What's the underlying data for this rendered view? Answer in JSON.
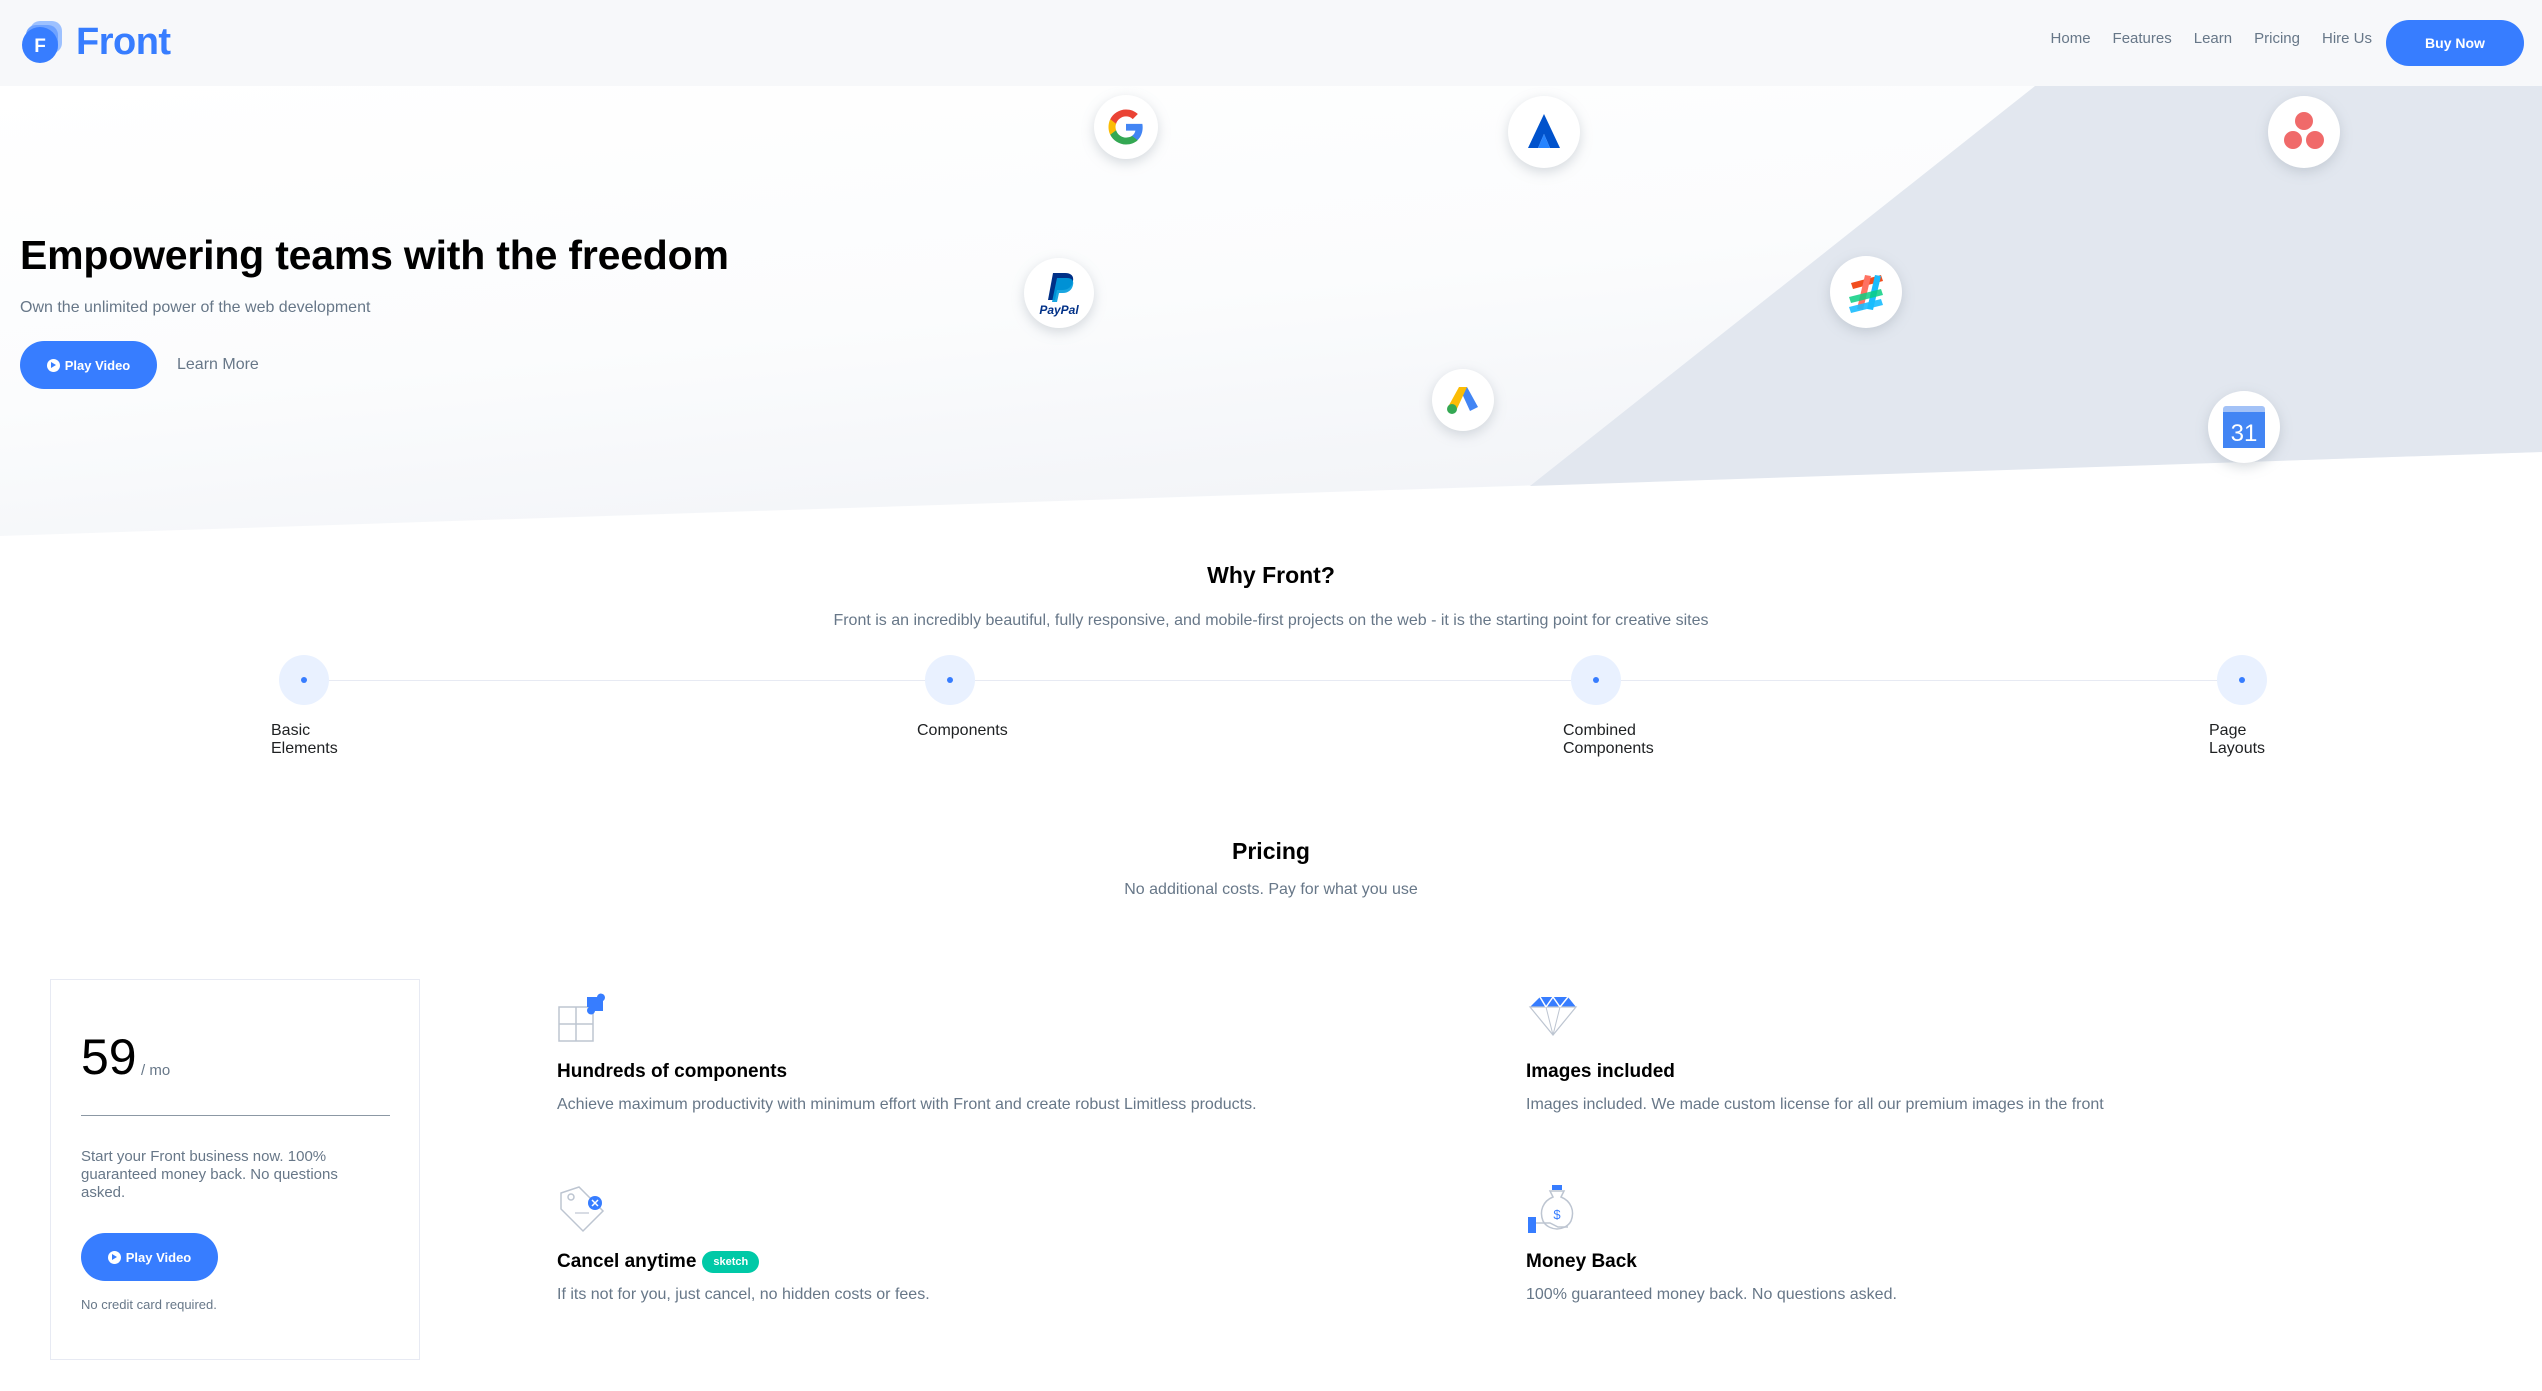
{
  "brand": {
    "name": "Front",
    "logo_letter": "F",
    "accent": "#377dff"
  },
  "nav": {
    "items": [
      "Home",
      "Features",
      "Learn",
      "Pricing",
      "Hire Us"
    ],
    "buy_label": "Buy Now"
  },
  "hero": {
    "title": "Empowering teams with the freedom",
    "subtitle": "Own the unlimited power of the web development",
    "play_label": "Play Video",
    "learn_more_label": "Learn More",
    "logos": [
      "google-icon",
      "atlassian-icon",
      "asana-icon",
      "paypal-icon",
      "zeplin-icon",
      "google-ads-icon",
      "google-calendar-icon"
    ],
    "paypal_text": "PayPal",
    "calendar_day": "31"
  },
  "why": {
    "title": "Why Front?",
    "subtitle": "Front is an incredibly beautiful, fully responsive, and mobile-first projects on the web - it is the starting point for creative sites",
    "steps": [
      "Basic\nElements",
      "Components",
      "Combined\nComponents",
      "Page\nLayouts"
    ]
  },
  "pricing": {
    "title": "Pricing",
    "subtitle": "No additional costs. Pay for what you use",
    "price": "59",
    "per": "/ mo",
    "description": "Start your Front business now. 100% guaranteed money back. No questions asked.",
    "play_label": "Play Video",
    "note": "No credit card required."
  },
  "features": [
    {
      "icon": "puzzle-icon",
      "title": "Hundreds of components",
      "desc": "Achieve maximum productivity with minimum effort with Front and create robust Limitless products."
    },
    {
      "icon": "diamond-icon",
      "title": "Images included",
      "desc": "Images included. We made custom license for all our premium images in the front"
    },
    {
      "icon": "price-tag-icon",
      "title": "Cancel anytime",
      "badge": "sketch",
      "desc": "If its not for you, just cancel, no hidden costs or fees."
    },
    {
      "icon": "money-bag-icon",
      "title": "Money Back",
      "desc": "100% guaranteed money back. No questions asked."
    }
  ]
}
